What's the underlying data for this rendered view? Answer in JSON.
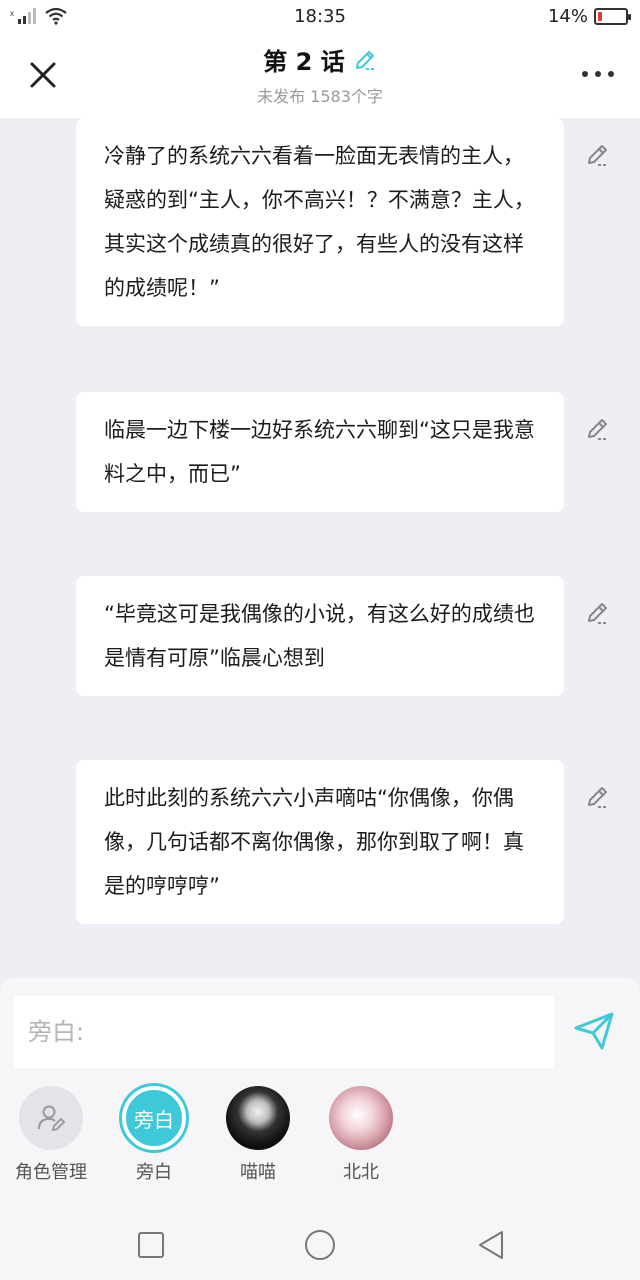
{
  "status_bar": {
    "time": "18:35",
    "battery_percent": "14%",
    "battery_level": 0.14,
    "battery_color": "#e53935",
    "icons": [
      "signal-icon",
      "wifi-icon",
      "battery-icon"
    ]
  },
  "header": {
    "title": "第 2 话",
    "subtitle": "未发布 1583个字",
    "accent_color": "#3ec9d8",
    "icons": [
      "close-icon",
      "pencil-icon",
      "more-icon"
    ]
  },
  "messages": [
    {
      "text": "冷静了的系统六六看着一脸面无表情的主人，疑惑的到“主人，你不高兴！？不满意？主人，其实这个成绩真的很好了，有些人的没有这样的成绩呢！”"
    },
    {
      "text": "临晨一边下楼一边好系统六六聊到“这只是我意料之中，而已”"
    },
    {
      "text": "“毕竟这可是我偶像的小说，有这么好的成绩也是情有可原”临晨心想到"
    },
    {
      "text": "此时此刻的系统六六小声嘀咕“你偶像，你偶像，几句话都不离你偶像，那你到取了啊！真是的哼哼哼”"
    }
  ],
  "composer": {
    "placeholder": "旁白:",
    "value": "",
    "send_icon": "send-icon"
  },
  "roles": [
    {
      "label": "角色管理",
      "icon": "role-manage-icon"
    },
    {
      "label": "旁白",
      "avatar_text": "旁白",
      "selected": true
    },
    {
      "label": "喵喵"
    },
    {
      "label": "北北"
    }
  ],
  "nav": {
    "icons": [
      "recent-apps-icon",
      "home-icon",
      "back-icon"
    ]
  }
}
